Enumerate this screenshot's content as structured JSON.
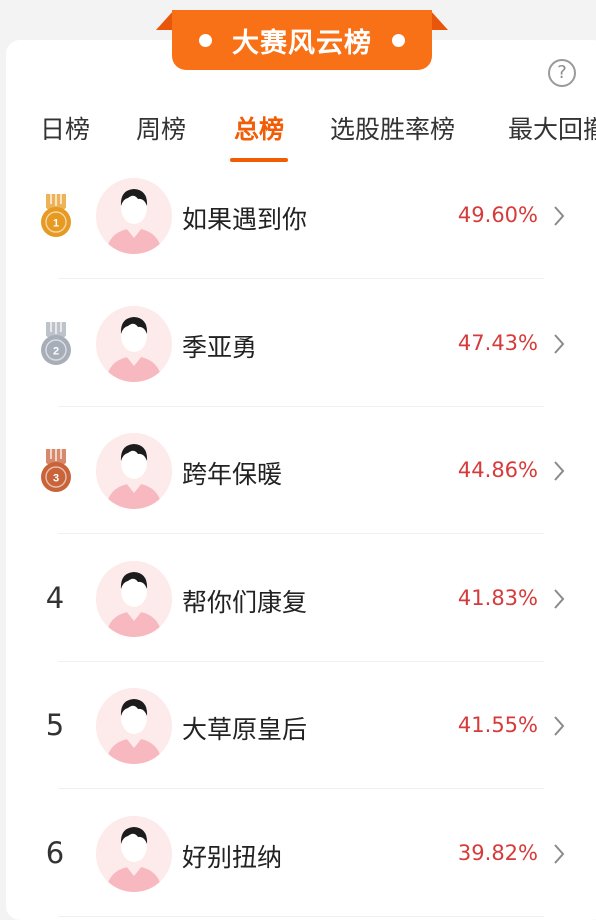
{
  "header": {
    "title": "大赛风云榜"
  },
  "help": {
    "glyph": "?"
  },
  "tabs": [
    {
      "label": "日榜",
      "active": false
    },
    {
      "label": "周榜",
      "active": false
    },
    {
      "label": "总榜",
      "active": true
    },
    {
      "label": "选股胜率榜",
      "active": false
    },
    {
      "label": "最大回撤",
      "active": false
    }
  ],
  "colors": {
    "accent": "#f25c05",
    "ribbon": "#f97116",
    "value": "#d63a3a",
    "gold": "#e79a22",
    "silver": "#a8aeb8",
    "bronze": "#c9633a"
  },
  "leaderboard": [
    {
      "rank": "1",
      "medal": "gold",
      "name": "如果遇到你",
      "value": "49.60%"
    },
    {
      "rank": "2",
      "medal": "silver",
      "name": "季亚勇",
      "value": "47.43%"
    },
    {
      "rank": "3",
      "medal": "bronze",
      "name": "跨年保暖",
      "value": "44.86%"
    },
    {
      "rank": "4",
      "name": "帮你们康复",
      "value": "41.83%"
    },
    {
      "rank": "5",
      "name": "大草原皇后",
      "value": "41.55%"
    },
    {
      "rank": "6",
      "name": "好别扭纳",
      "value": "39.82%"
    }
  ]
}
